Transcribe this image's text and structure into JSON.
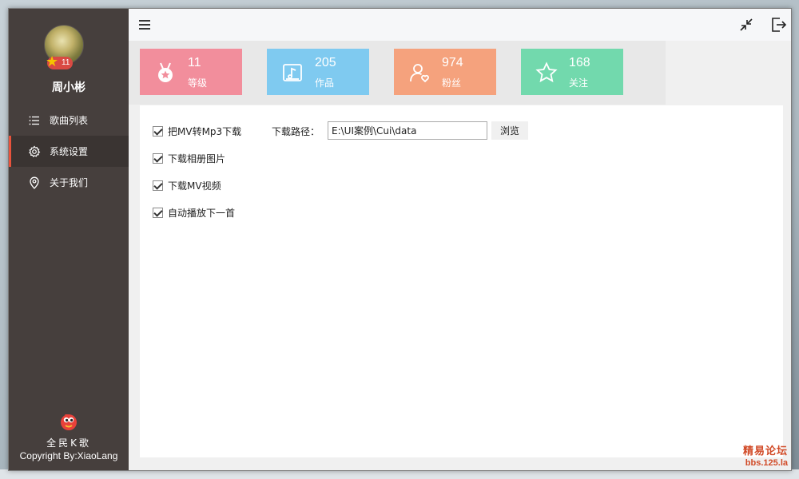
{
  "app": {
    "user_name": "周小彬",
    "user_level": "11",
    "brand_name": "全民K歌",
    "brand_copyright": "Copyright By:XiaoLang"
  },
  "sidebar": {
    "items": [
      {
        "label": "歌曲列表",
        "icon": "list-icon"
      },
      {
        "label": "系统设置",
        "icon": "gear-icon",
        "active": true
      },
      {
        "label": "关于我们",
        "icon": "location-pin-icon"
      }
    ]
  },
  "toolbar": {
    "menu_icon": "hamburger-menu-icon",
    "minimize_icon": "shrink-icon",
    "exit_icon": "exit-icon"
  },
  "stats": [
    {
      "value": "11",
      "label": "等级",
      "color": "#f28e9c",
      "icon": "medal-icon"
    },
    {
      "value": "205",
      "label": "作品",
      "color": "#7fcaf0",
      "icon": "music-note-icon"
    },
    {
      "value": "974",
      "label": "粉丝",
      "color": "#f5a27d",
      "icon": "user-heart-icon"
    },
    {
      "value": "168",
      "label": "关注",
      "color": "#72d9ad",
      "icon": "star-icon"
    }
  ],
  "settings": {
    "options": [
      {
        "label": "把MV转Mp3下载",
        "checked": true
      },
      {
        "label": "下载相册图片",
        "checked": true
      },
      {
        "label": "下载MV视频",
        "checked": true
      },
      {
        "label": "自动播放下一首",
        "checked": true
      }
    ],
    "path_label": "下载路径：",
    "path_value": "E:\\UI案例\\Cui\\data",
    "browse_label": "浏览"
  },
  "watermark": {
    "line1": "精易论坛",
    "line2": "bbs.125.la"
  },
  "colors": {
    "sidebar_bg": "#463f3d",
    "active_indicator": "#e8533c"
  }
}
